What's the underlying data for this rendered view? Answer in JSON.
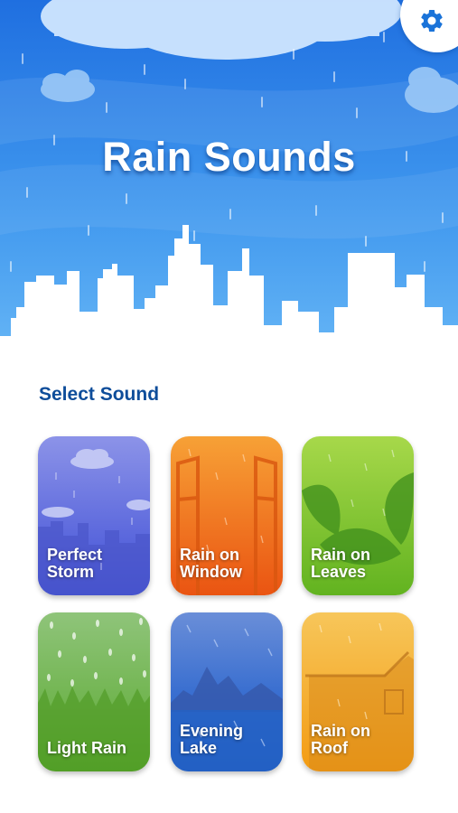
{
  "app": {
    "title": "Rain Sounds"
  },
  "header": {
    "settings_icon": "gear-icon",
    "accent": "#2f86e6"
  },
  "section": {
    "title": "Select Sound"
  },
  "sounds": [
    {
      "label": "Perfect Storm",
      "color": "#5b6fe0"
    },
    {
      "label": "Rain on Window",
      "color": "#f26b1d"
    },
    {
      "label": "Rain on Leaves",
      "color": "#7cc12a"
    },
    {
      "label": "Light Rain",
      "color": "#6fb844"
    },
    {
      "label": "Evening Lake",
      "color": "#1f66c9"
    },
    {
      "label": "Rain on Roof",
      "color": "#f6a61b"
    }
  ]
}
